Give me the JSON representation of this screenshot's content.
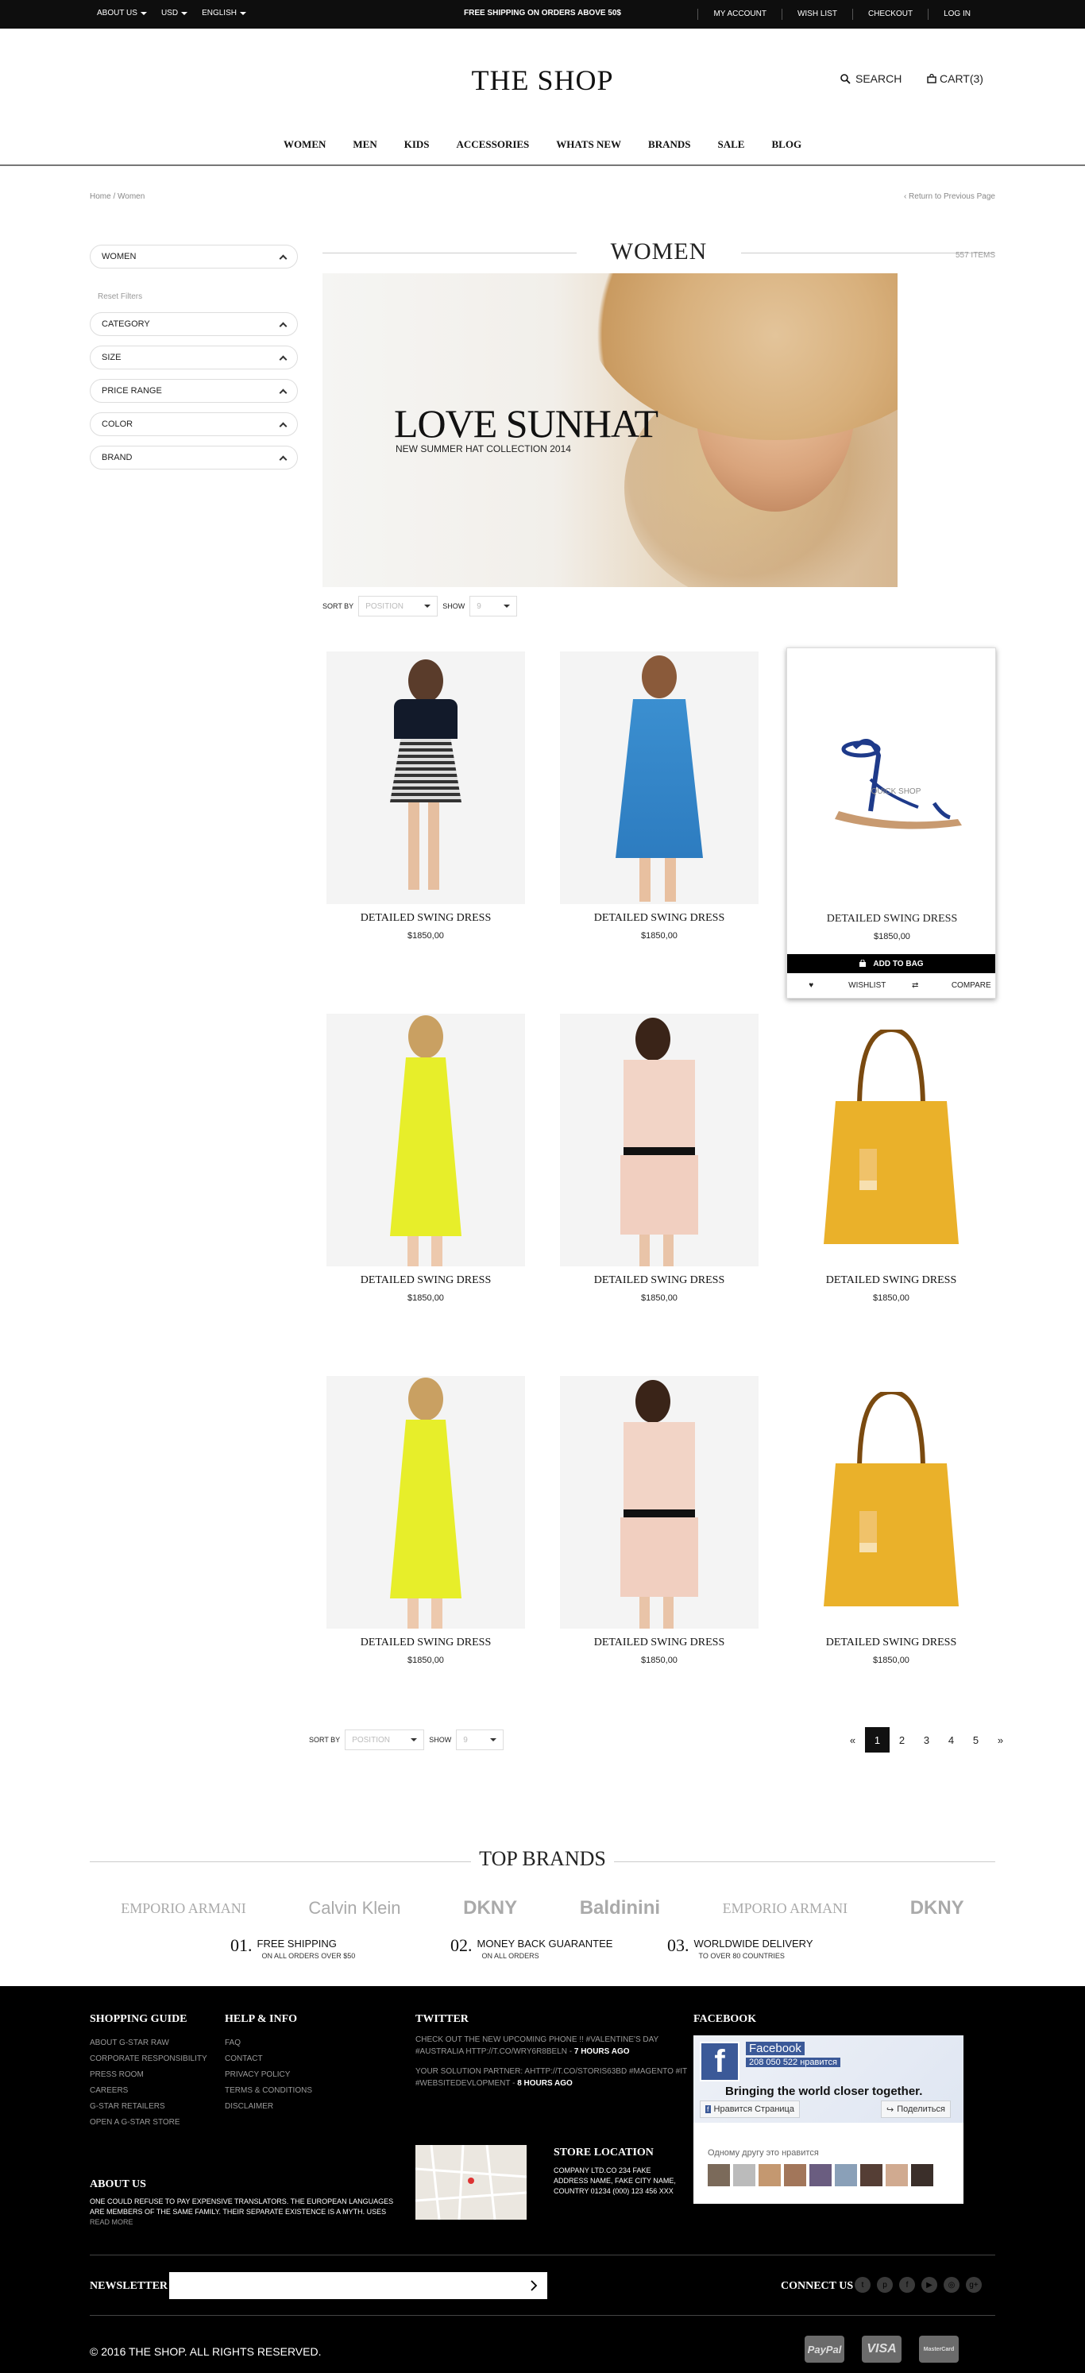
{
  "topbar": {
    "about": "ABOUT US",
    "currency": "USD",
    "language": "ENGLISH",
    "shipping": "FREE SHIPPING ON ORDERS ABOVE 50$",
    "links": [
      "MY ACCOUNT",
      "WISH LIST",
      "CHECKOUT",
      "LOG IN"
    ]
  },
  "header": {
    "logo": "THE SHOP",
    "search": "SEARCH",
    "cart": "CART(3)"
  },
  "nav": [
    "WOMEN",
    "MEN",
    "KIDS",
    "ACCESSORIES",
    "WHATS NEW",
    "BRANDS",
    "SALE",
    "BLOG"
  ],
  "breadcrumb": "Home / Women",
  "return_link": "‹ Return to Previous Page",
  "sidebar": {
    "current": "WOMEN",
    "reset": "Reset Filters",
    "filters": [
      "CATEGORY",
      "SIZE",
      "PRICE RANGE",
      "COLOR",
      "BRAND"
    ]
  },
  "page": {
    "title": "WOMEN",
    "items_count": "557 ITEMS"
  },
  "banner": {
    "title": "LOVE SUNHAT",
    "subtitle": "NEW SUMMER HAT COLLECTION 2014"
  },
  "sort": {
    "sort_by": "SORT BY",
    "sort_value": "Position",
    "show": "SHOW",
    "show_value": "9"
  },
  "products": [
    {
      "name": "DETAILED SWING DRESS",
      "price": "$1850,00"
    },
    {
      "name": "DETAILED SWING DRESS",
      "price": "$1850,00"
    },
    {
      "name": "DETAILED SWING DRESS",
      "price": "$1850,00"
    },
    {
      "name": "DETAILED SWING DRESS",
      "price": "$1850,00"
    },
    {
      "name": "DETAILED SWING DRESS",
      "price": "$1850,00"
    },
    {
      "name": "DETAILED SWING DRESS",
      "price": "$1850,00"
    },
    {
      "name": "DETAILED SWING DRESS",
      "price": "$1850,00"
    },
    {
      "name": "DETAILED SWING DRESS",
      "price": "$1850,00"
    },
    {
      "name": "DETAILED SWING DRESS",
      "price": "$1850,00"
    }
  ],
  "hover": {
    "quick_shop": "QUICK SHOP",
    "add_to_bag": "ADD TO BAG",
    "wishlist": "WISHLIST",
    "compare": "COMPARE"
  },
  "pagination": {
    "prev": "«",
    "pages": [
      "1",
      "2",
      "3",
      "4",
      "5"
    ],
    "next": "»",
    "active": "1"
  },
  "brands": {
    "title": "TOP BRANDS",
    "logos": [
      "EMPORIO ARMANI",
      "Calvin Klein",
      "DKNY",
      "Baldinini",
      "EMPORIO ARMANI",
      "DKNY"
    ]
  },
  "features": [
    {
      "num": "01.",
      "title": "FREE SHIPPING",
      "sub": "ON ALL ORDERS OVER $50"
    },
    {
      "num": "02.",
      "title": "MONEY BACK GUARANTEE",
      "sub": "ON ALL ORDERS"
    },
    {
      "num": "03.",
      "title": "WORLDWIDE DELIVERY",
      "sub": "TO OVER 80 COUNTRIES"
    }
  ],
  "footer": {
    "shopping_guide": {
      "title": "SHOPPING GUIDE",
      "items": [
        "ABOUT G-STAR RAW",
        "CORPORATE RESPONSIBILITY",
        "PRESS ROOM",
        "CAREERS",
        "G-STAR RETAILERS",
        "OPEN A G-STAR STORE"
      ]
    },
    "help": {
      "title": "HELP & INFO",
      "items": [
        "FAQ",
        "CONTACT",
        "PRIVACY POLICY",
        "TERMS & CONDITIONS",
        "DISCLAIMER"
      ]
    },
    "twitter": {
      "title": "TWITTER",
      "tweet1": "CHECK OUT THE NEW UPCOMING PHONE !! #VALENTINE'S DAY #AUSTRALIA HTTP://T.CO/WRY6R8BELN -",
      "tweet1_time": "7 HOURS AGO",
      "tweet2": "YOUR SOLUTION PARTNER: AHTTP://T.CO/STORIS63BD #MAGENTO #IT #WEBSITEDEVLOPMENT -",
      "tweet2_time": "8 HOURS AGO"
    },
    "facebook": {
      "title": "FACEBOOK",
      "page_name": "Facebook",
      "likes": "208 050 522 нравится",
      "tagline": "Bringing the world closer together.",
      "like_button": "Нравится Страница",
      "share_button": "Поделиться",
      "friend_text": "Одному другу это нравится"
    },
    "about": {
      "title": "ABOUT US",
      "text": "ONE COULD REFUSE TO PAY EXPENSIVE TRANSLATORS. THE EUROPEAN LANGUAGES ARE MEMBERS OF THE SAME FAMILY. THEIR SEPARATE EXISTENCE IS A MYTH. USES",
      "read_more": "READ MORE"
    },
    "store": {
      "title": "STORE LOCATION",
      "address": "COMPANY LTD.CO 234 FAKE ADDRESS NAME, FAKE CITY NAME, COUNTRY 01234 (000) 123 456 XXX"
    },
    "newsletter": "NEWSLETTER",
    "connect": "CONNECT US",
    "copyright": "© 2016 THE SHOP. ALL RIGHTS RESERVED.",
    "payments": [
      "PayPal",
      "VISA",
      "MasterCard"
    ]
  }
}
